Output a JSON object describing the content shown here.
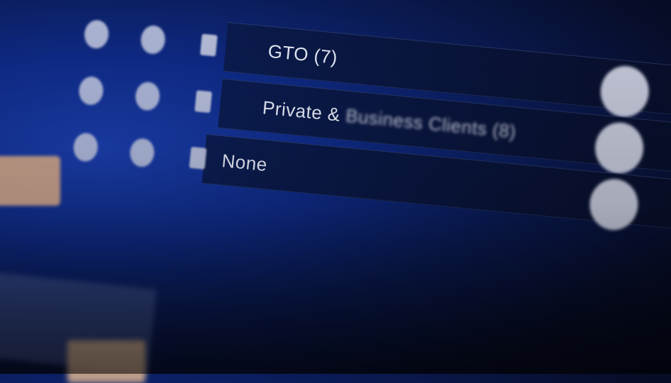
{
  "options": [
    {
      "label": "GTO (7)"
    },
    {
      "label_main": "Private & ",
      "label_blurred": "Business Clients (8)"
    },
    {
      "label": "None"
    }
  ],
  "colors": {
    "accent": "#1b3fb0",
    "chip": "#e8b58c"
  }
}
